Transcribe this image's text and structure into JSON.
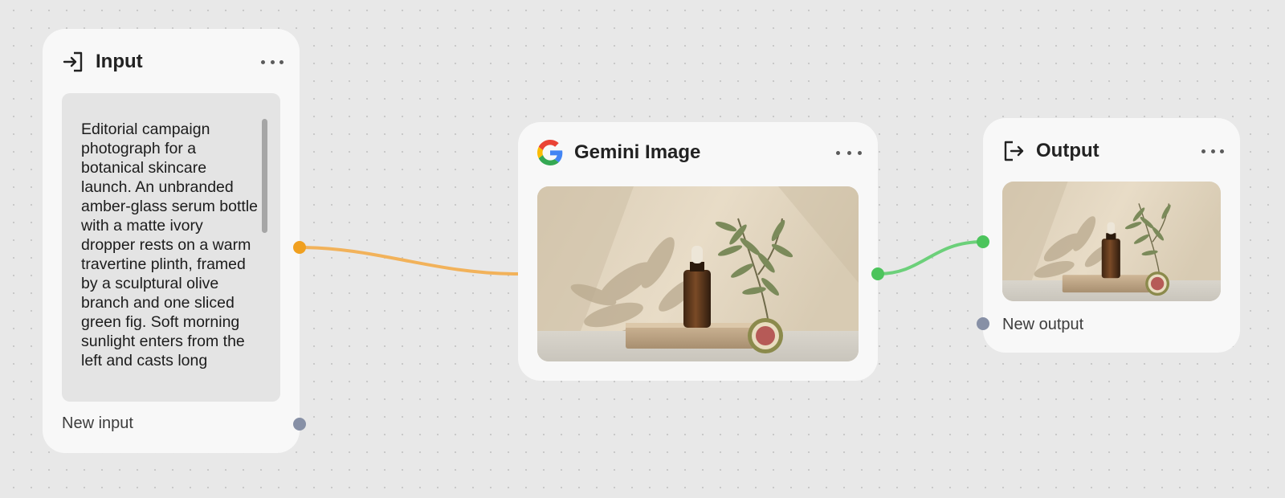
{
  "nodes": {
    "input": {
      "title": "Input",
      "prompt": "Editorial campaign photograph for a botanical skincare launch. An unbranded amber-glass serum bottle with a matte ivory dropper rests on a warm travertine plinth, framed by a sculptural olive branch and one sliced green fig. Soft morning sunlight enters from the left and casts long",
      "port_label": "New input",
      "icon": "login-arrow-icon"
    },
    "gemini": {
      "title": "Gemini Image",
      "icon": "google-g-icon"
    },
    "output": {
      "title": "Output",
      "port_label": "New output",
      "icon": "logout-arrow-icon"
    }
  },
  "colors": {
    "canvas": "#e8e8e8",
    "node": "#f8f8f8",
    "wire_input": "#f2b25a",
    "port_input": "#f0a020",
    "wire_output": "#6cd07a",
    "port_output": "#4cc45c",
    "port_idle": "#8790a6"
  }
}
